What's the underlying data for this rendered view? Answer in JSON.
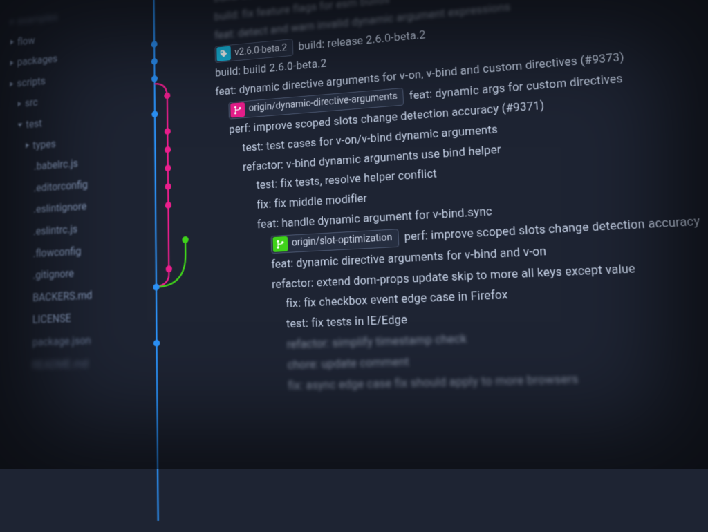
{
  "sidebar": {
    "items": [
      {
        "label": "examples",
        "icon": "tri-closed",
        "indent": 0,
        "blur": 2
      },
      {
        "label": "flow",
        "icon": "tri-closed",
        "indent": 0,
        "blur": 0
      },
      {
        "label": "packages",
        "icon": "tri-closed",
        "indent": 0,
        "blur": 0
      },
      {
        "label": "scripts",
        "icon": "tri-closed",
        "indent": 0,
        "blur": 0
      },
      {
        "label": "src",
        "icon": "tri-closed",
        "indent": 1,
        "blur": 0
      },
      {
        "label": "test",
        "icon": "tri-open",
        "indent": 1,
        "blur": 0
      },
      {
        "label": "types",
        "icon": "tri-closed",
        "indent": 2,
        "blur": 0
      },
      {
        "label": ".babelrc.js",
        "icon": "",
        "indent": 3,
        "blur": 0
      },
      {
        "label": ".editorconfig",
        "icon": "",
        "indent": 3,
        "blur": 0
      },
      {
        "label": ".eslintignore",
        "icon": "",
        "indent": 3,
        "blur": 0
      },
      {
        "label": ".eslintrc.js",
        "icon": "",
        "indent": 3,
        "blur": 0
      },
      {
        "label": ".flowconfig",
        "icon": "",
        "indent": 3,
        "blur": 0
      },
      {
        "label": ".gitignore",
        "icon": "",
        "indent": 3,
        "blur": 0
      },
      {
        "label": "BACKERS.md",
        "icon": "",
        "indent": 3,
        "blur": 0
      },
      {
        "label": "LICENSE",
        "icon": "",
        "indent": 3,
        "blur": 0
      },
      {
        "label": "package.json",
        "icon": "",
        "indent": 3,
        "blur": 1
      },
      {
        "label": "README.md",
        "icon": "",
        "indent": 3,
        "blur": 2
      }
    ]
  },
  "commits": [
    {
      "text": "build: build 2.6.0-beta.2",
      "style": "blur-top",
      "pad": 0
    },
    {
      "text": "build: fix feature flags for esm builds",
      "style": "blur-top",
      "pad": 0
    },
    {
      "text": "feat: detect and warn invalid dynamic argument expressions",
      "style": "blur-top",
      "pad": 0
    },
    {
      "tag": {
        "type": "cyan",
        "icon": "tag",
        "label": "v2.6.0-beta.2"
      },
      "text": "build: release 2.6.0-beta.2",
      "pad": 0,
      "style": ""
    },
    {
      "text": "build: build 2.6.0-beta.2",
      "pad": 0,
      "style": ""
    },
    {
      "text": "feat: dynamic directive arguments for v-on, v-bind and custom directives (#9373)",
      "pad": 0,
      "style": ""
    },
    {
      "tag": {
        "type": "pink",
        "icon": "branch",
        "label": "origin/dynamic-directive-arguments"
      },
      "text": "feat: dynamic args for custom directives",
      "pad": 1,
      "style": ""
    },
    {
      "text": "perf: improve scoped slots change detection accuracy (#9371)",
      "pad": 1,
      "style": ""
    },
    {
      "text": "test: test cases for v-on/v-bind dynamic arguments",
      "pad": 2,
      "style": ""
    },
    {
      "text": "refactor: v-bind dynamic arguments use bind helper",
      "pad": 2,
      "style": ""
    },
    {
      "text": "test: fix tests, resolve helper conflict",
      "pad": 3,
      "style": ""
    },
    {
      "text": "fix: fix middle modifier",
      "pad": 3,
      "style": ""
    },
    {
      "text": "feat: handle dynamic argument for v-bind.sync",
      "pad": 3,
      "style": ""
    },
    {
      "tag": {
        "type": "green",
        "icon": "branch",
        "label": "origin/slot-optimization"
      },
      "text": "perf: improve scoped slots change detection accuracy",
      "pad": 4,
      "style": ""
    },
    {
      "text": "feat: dynamic directive arguments for v-bind and v-on",
      "pad": 4,
      "style": ""
    },
    {
      "text": "refactor: extend dom-props update skip to more all keys except value",
      "pad": 4,
      "style": ""
    },
    {
      "text": "fix: fix checkbox event edge case in Firefox",
      "pad": 5,
      "style": ""
    },
    {
      "text": "test: fix tests in IE/Edge",
      "pad": 5,
      "style": ""
    },
    {
      "text": "refactor: simplify timestamp check",
      "pad": 5,
      "style": "blur-bot"
    },
    {
      "text": "chore: update comment",
      "pad": 5,
      "style": "blur-bot"
    },
    {
      "text": "fix: async edge case fix should apply to more browsers",
      "pad": 5,
      "style": "blur-bot"
    }
  ],
  "colors": {
    "bg": "#1e2433",
    "cyan": "#18b8e0",
    "blue": "#2b90f5",
    "pink": "#e91e8c",
    "green": "#3fd21a"
  }
}
